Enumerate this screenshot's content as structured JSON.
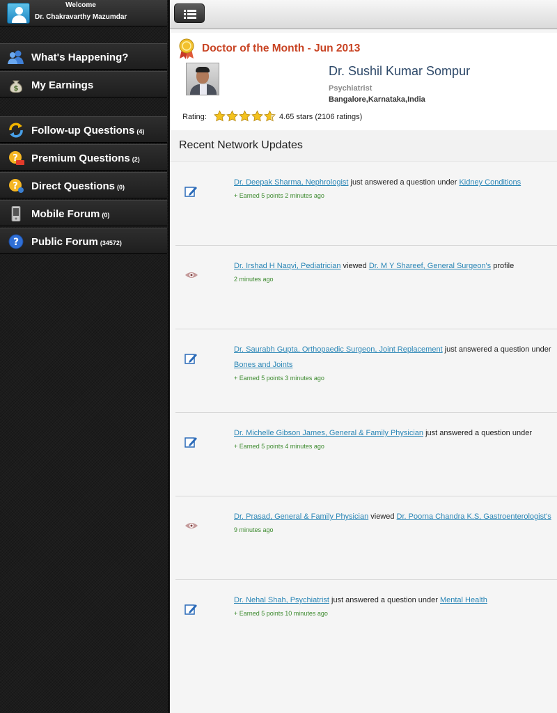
{
  "sidebar": {
    "welcome_label": "Welcome",
    "user_name": "Dr. Chakravarthy Mazumdar",
    "items": [
      {
        "label": "What's Happening?",
        "count": "",
        "icon": "users-icon"
      },
      {
        "label": "My Earnings",
        "count": "",
        "icon": "money-bag-icon"
      },
      {
        "label": "Follow-up Questions",
        "count": "(4)",
        "icon": "refresh-icon"
      },
      {
        "label": "Premium Questions",
        "count": "(2)",
        "icon": "premium-question-icon"
      },
      {
        "label": "Direct Questions",
        "count": "(0)",
        "icon": "direct-question-icon"
      },
      {
        "label": "Mobile Forum",
        "count": "(0)",
        "icon": "mobile-phone-icon"
      },
      {
        "label": "Public Forum",
        "count": "(34572)",
        "icon": "help-icon"
      }
    ]
  },
  "dotm": {
    "title": "Doctor of the Month - Jun 2013",
    "name": "Dr. Sushil Kumar Sompur",
    "specialty": "Psychiatrist",
    "location": "Bangalore,Karnataka,India",
    "rating_label": "Rating:",
    "stars": 4.65,
    "rating_text": "4.65 stars (2106 ratings)"
  },
  "updates": {
    "title": "Recent Network Updates",
    "items": [
      {
        "type": "answer",
        "icon": "edit-icon",
        "actor": "Dr. Deepak Sharma, Nephrologist",
        "action": " just answered a question under ",
        "target": "Kidney Conditions",
        "suffix": "",
        "meta": "+ Earned 5 points 2 minutes ago"
      },
      {
        "type": "view",
        "icon": "eye-icon",
        "actor": "Dr. Irshad H Naqvi, Pediatrician",
        "action": " viewed ",
        "target": "Dr. M Y Shareef, General Surgeon's",
        "suffix": " profile",
        "meta": "2 minutes ago"
      },
      {
        "type": "answer",
        "icon": "edit-icon",
        "actor": "Dr. Saurabh Gupta, Orthopaedic Surgeon, Joint Replacement",
        "action": " just answered a question under ",
        "target": "Bones and Joints",
        "suffix": "",
        "meta": "+ Earned 5 points 3 minutes ago"
      },
      {
        "type": "answer",
        "icon": "edit-icon",
        "actor": "Dr. Michelle Gibson James, General & Family Physician",
        "action": " just answered a question under ",
        "target": "",
        "suffix": "",
        "meta": "+ Earned 5 points 4 minutes ago"
      },
      {
        "type": "view",
        "icon": "eye-icon",
        "actor": "Dr. Prasad, General & Family Physician",
        "action": " viewed ",
        "target": "Dr. Poorna Chandra K.S, Gastroenterologist's",
        "suffix": "",
        "meta": "9 minutes ago"
      },
      {
        "type": "answer",
        "icon": "edit-icon",
        "actor": "Dr. Nehal Shah, Psychiatrist",
        "action": " just answered a question under ",
        "target": "Mental Health",
        "suffix": "",
        "meta": "+ Earned 5 points 10 minutes ago"
      }
    ]
  }
}
